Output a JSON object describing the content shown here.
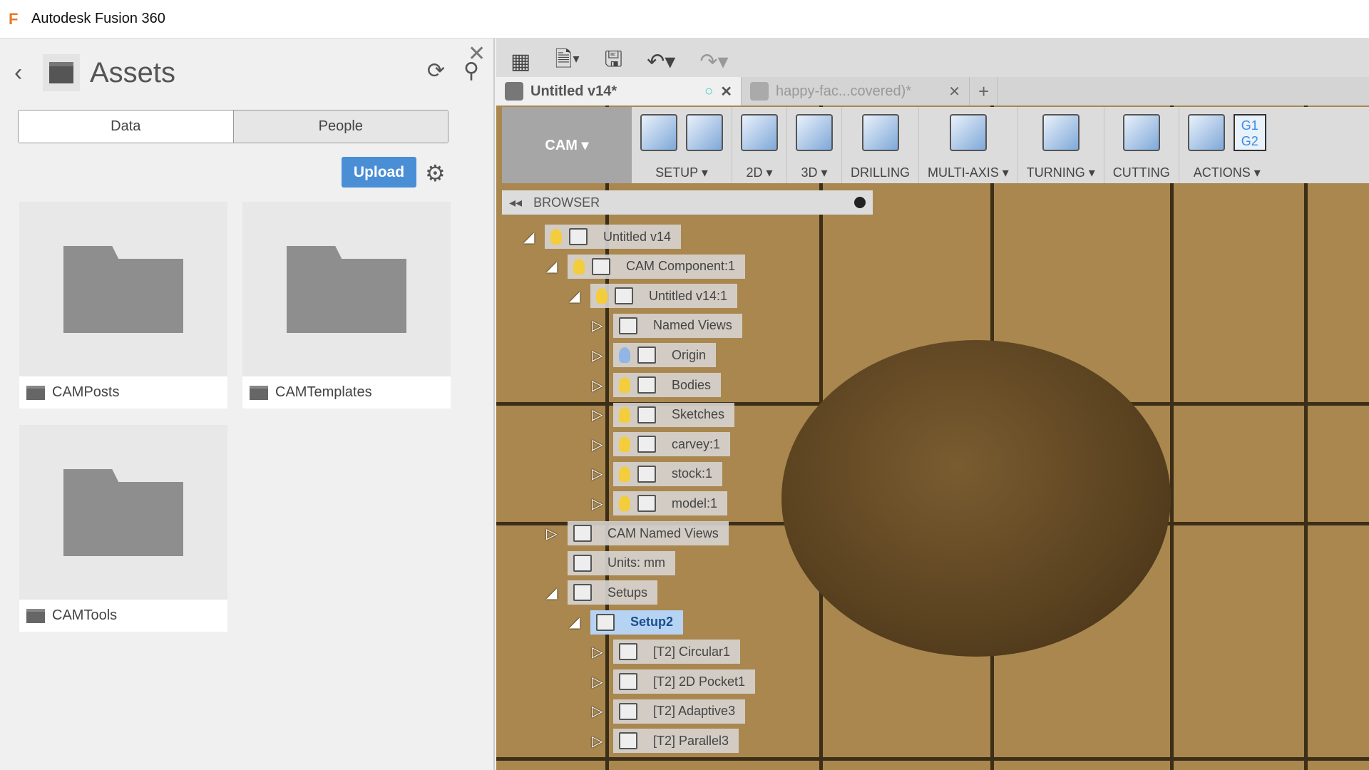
{
  "app_title": "Autodesk Fusion 360",
  "assets": {
    "title": "Assets",
    "tabs": [
      "Data",
      "People"
    ],
    "upload_label": "Upload",
    "folders": [
      "CAMPosts",
      "CAMTemplates",
      "CAMTools"
    ]
  },
  "doc_tabs": [
    {
      "label": "Untitled v14*"
    },
    {
      "label": "happy-fac...covered)*"
    }
  ],
  "ribbon": {
    "workspace": "CAM ▾",
    "groups": [
      "SETUP ▾",
      "2D ▾",
      "3D ▾",
      "DRILLING",
      "MULTI-AXIS ▾",
      "TURNING ▾",
      "CUTTING",
      "ACTIONS ▾"
    ],
    "actions_icon_text": "G1 G2"
  },
  "browser": {
    "title": "BROWSER",
    "items": [
      {
        "level": 0,
        "exp": "open",
        "bulb": "y",
        "icon": "comp",
        "label": "Untitled v14"
      },
      {
        "level": 1,
        "exp": "open",
        "bulb": "y",
        "icon": "comp",
        "label": "CAM Component:1"
      },
      {
        "level": 2,
        "exp": "open",
        "bulb": "y",
        "icon": "comp",
        "label": "Untitled v14:1"
      },
      {
        "level": 3,
        "exp": "closed",
        "bulb": "",
        "icon": "folder",
        "label": "Named Views"
      },
      {
        "level": 3,
        "exp": "closed",
        "bulb": "b",
        "icon": "folder",
        "label": "Origin"
      },
      {
        "level": 3,
        "exp": "closed",
        "bulb": "y",
        "icon": "folder",
        "label": "Bodies"
      },
      {
        "level": 3,
        "exp": "closed",
        "bulb": "y",
        "icon": "folder",
        "label": "Sketches"
      },
      {
        "level": 3,
        "exp": "closed",
        "bulb": "y",
        "icon": "comp",
        "label": "carvey:1"
      },
      {
        "level": 3,
        "exp": "closed",
        "bulb": "y",
        "icon": "body",
        "label": "stock:1"
      },
      {
        "level": 3,
        "exp": "closed",
        "bulb": "y",
        "icon": "body",
        "label": "model:1"
      },
      {
        "level": 1,
        "exp": "closed",
        "bulb": "",
        "icon": "folder",
        "label": "CAM Named Views"
      },
      {
        "level": 1,
        "exp": "",
        "bulb": "",
        "icon": "doc",
        "label": "Units: mm"
      },
      {
        "level": 1,
        "exp": "open",
        "bulb": "",
        "icon": "setup",
        "label": "Setups"
      },
      {
        "level": 2,
        "exp": "open",
        "bulb": "",
        "icon": "setup",
        "label": "Setup2",
        "selected": true
      },
      {
        "level": 3,
        "exp": "closed",
        "bulb": "",
        "icon": "op",
        "label": "[T2] Circular1"
      },
      {
        "level": 3,
        "exp": "closed",
        "bulb": "",
        "icon": "op",
        "label": "[T2] 2D Pocket1"
      },
      {
        "level": 3,
        "exp": "closed",
        "bulb": "",
        "icon": "op",
        "label": "[T2] Adaptive3"
      },
      {
        "level": 3,
        "exp": "closed",
        "bulb": "",
        "icon": "op",
        "label": "[T2] Parallel3"
      }
    ]
  }
}
